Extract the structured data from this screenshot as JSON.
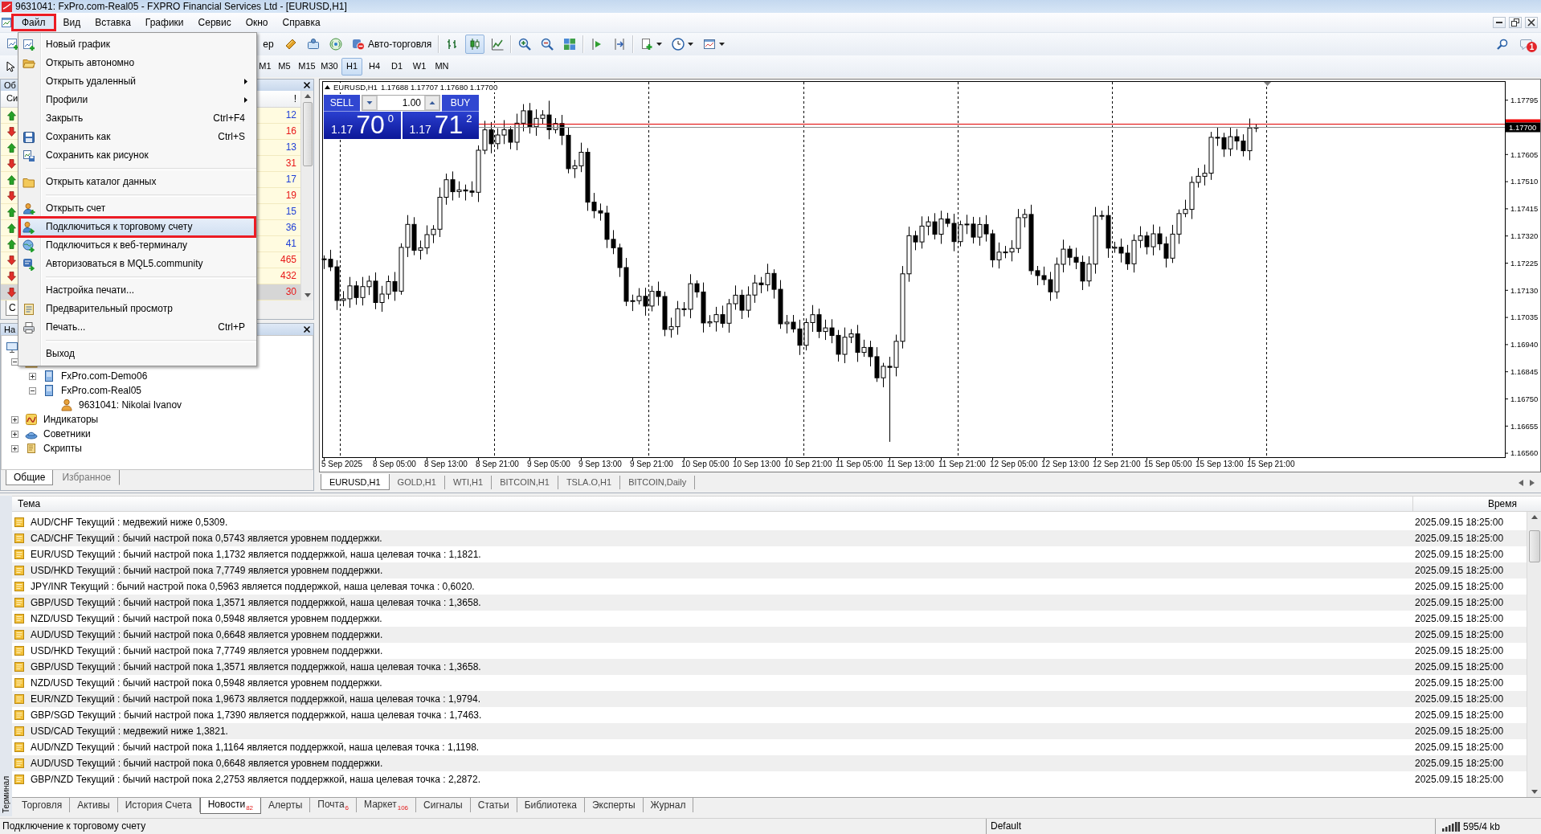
{
  "window": {
    "title": "9631041: FxPro.com-Real05 - FXPRO Financial Services Ltd - [EURUSD,H1]"
  },
  "menu_bar": [
    {
      "label": "Файл",
      "selected": true,
      "annotated": true
    },
    {
      "label": "Вид",
      "selected": false,
      "annotated": false
    },
    {
      "label": "Вставка",
      "selected": false,
      "annotated": false
    },
    {
      "label": "Графики",
      "selected": false,
      "annotated": false
    },
    {
      "label": "Сервис",
      "selected": false,
      "annotated": false
    },
    {
      "label": "Окно",
      "selected": false,
      "annotated": false
    },
    {
      "label": "Справка",
      "selected": false,
      "annotated": false
    }
  ],
  "file_menu": {
    "groups": [
      [
        {
          "label": "Новый график",
          "submenu": false,
          "selected": false,
          "annotated": false
        },
        {
          "label": "Открыть автономно",
          "submenu": false,
          "selected": false,
          "annotated": false
        },
        {
          "label": "Открыть удаленный",
          "submenu": true,
          "selected": false,
          "annotated": false
        },
        {
          "label": "Профили",
          "submenu": true,
          "selected": false,
          "annotated": false
        },
        {
          "label": "Закрыть",
          "shortcut": "Ctrl+F4",
          "submenu": false,
          "selected": false,
          "annotated": false
        },
        {
          "label": "Сохранить как",
          "shortcut": "Ctrl+S",
          "submenu": false,
          "selected": false,
          "annotated": false
        },
        {
          "label": "Сохранить как рисунок",
          "submenu": false,
          "selected": false,
          "annotated": false
        }
      ],
      [
        {
          "label": "Открыть каталог данных",
          "submenu": false,
          "selected": false,
          "annotated": false
        }
      ],
      [
        {
          "label": "Открыть счет",
          "submenu": false,
          "selected": false,
          "annotated": false
        },
        {
          "label": "Подключиться к торговому счету",
          "submenu": false,
          "selected": true,
          "annotated": true
        },
        {
          "label": "Подключиться к веб-терминалу",
          "submenu": false,
          "selected": false,
          "annotated": false
        },
        {
          "label": "Авторизоваться в MQL5.community",
          "submenu": false,
          "selected": false,
          "annotated": false
        }
      ],
      [
        {
          "label": "Настройка печати...",
          "submenu": false,
          "selected": false,
          "annotated": false
        },
        {
          "label": "Предварительный просмотр",
          "submenu": false,
          "selected": false,
          "annotated": false
        },
        {
          "label": "Печать...",
          "shortcut": "Ctrl+P",
          "submenu": false,
          "selected": false,
          "annotated": false
        }
      ],
      [
        {
          "label": "Выход",
          "submenu": false,
          "selected": false,
          "annotated": false
        }
      ]
    ]
  },
  "toolbar": {
    "groups": [
      [
        {
          "pressed": false,
          "dropdown": false
        }
      ],
      [
        {
          "label": "ер",
          "pressed": false,
          "dropdown": false
        },
        {
          "pressed": false,
          "dropdown": false
        },
        {
          "pressed": false,
          "dropdown": false
        },
        {
          "pressed": false,
          "dropdown": false
        },
        {
          "label": "Авто-торговля",
          "pressed": false,
          "dropdown": false
        }
      ],
      [
        {
          "pressed": false,
          "dropdown": false
        },
        {
          "pressed": true,
          "dropdown": false
        },
        {
          "pressed": false,
          "dropdown": false
        }
      ],
      [
        {
          "pressed": false,
          "dropdown": false
        },
        {
          "pressed": false,
          "dropdown": false
        },
        {
          "pressed": false,
          "dropdown": false
        }
      ],
      [
        {
          "pressed": false,
          "dropdown": false
        },
        {
          "pressed": false,
          "dropdown": false
        }
      ],
      [
        {
          "pressed": false,
          "dropdown": true
        },
        {
          "pressed": false,
          "dropdown": true
        },
        {
          "pressed": false,
          "dropdown": true
        }
      ]
    ],
    "notifications": {
      "badge": "1"
    }
  },
  "timeframes": [
    {
      "label": "M1",
      "selected": false
    },
    {
      "label": "M5",
      "selected": false
    },
    {
      "label": "M15",
      "selected": false
    },
    {
      "label": "M30",
      "selected": false
    },
    {
      "label": "H1",
      "selected": true
    },
    {
      "label": "H4",
      "selected": false
    },
    {
      "label": "D1",
      "selected": false
    },
    {
      "label": "W1",
      "selected": false
    },
    {
      "label": "MN",
      "selected": false
    }
  ],
  "market_watch": {
    "title": "Об",
    "columns": [
      "Си",
      "!"
    ],
    "rows": [
      {
        "rising": true,
        "spread": "12",
        "selected": false
      },
      {
        "rising": false,
        "spread": "16",
        "selected": false
      },
      {
        "rising": true,
        "spread": "13",
        "selected": false
      },
      {
        "rising": false,
        "spread": "31",
        "selected": false
      },
      {
        "rising": true,
        "spread": "17",
        "selected": false
      },
      {
        "rising": false,
        "spread": "19",
        "selected": false
      },
      {
        "rising": true,
        "spread": "15",
        "selected": false
      },
      {
        "rising": true,
        "spread": "36",
        "selected": false
      },
      {
        "rising": true,
        "spread": "41",
        "selected": false
      },
      {
        "rising": false,
        "spread": "465",
        "selected": false
      },
      {
        "rising": false,
        "spread": "432",
        "selected": false
      },
      {
        "rising": false,
        "spread": "30",
        "selected": true
      }
    ],
    "tabs": [
      {
        "label": "С",
        "selected": true
      }
    ]
  },
  "navigator": {
    "title": "На",
    "tree": [
      {
        "kind": "terminal",
        "children": [
          {
            "kind": "accounts",
            "expanded": true,
            "children": [
              {
                "kind": "server",
                "label": "FxPro.com-Demo06",
                "expanded": false
              },
              {
                "kind": "server",
                "label": "FxPro.com-Real05",
                "expanded": true,
                "children": [
                  {
                    "kind": "account",
                    "label": "9631041: Nikolai Ivanov"
                  }
                ]
              }
            ]
          },
          {
            "kind": "indicators",
            "label": "Индикаторы",
            "expanded": false
          },
          {
            "kind": "experts",
            "label": "Советники",
            "expanded": false
          },
          {
            "kind": "scripts",
            "label": "Скрипты",
            "expanded": false
          }
        ]
      }
    ],
    "tabs": [
      {
        "label": "Общие",
        "selected": true
      },
      {
        "label": "Избранное",
        "selected": false
      }
    ]
  },
  "chart": {
    "symbol": "EURUSD,H1",
    "ohlc": "1.17688 1.17707 1.17680 1.17700",
    "trade_panel": {
      "sell_label": "SELL",
      "buy_label": "BUY",
      "lot": "1.00",
      "sell_price": {
        "prefix": "1.17",
        "pips": "70",
        "point": "0"
      },
      "buy_price": {
        "prefix": "1.17",
        "pips": "71",
        "point": "2"
      }
    },
    "price_axis": [
      "1.17795",
      "1.17605",
      "1.17510",
      "1.17415",
      "1.17320",
      "1.17225",
      "1.17130",
      "1.17035",
      "1.16940",
      "1.16845",
      "1.16750",
      "1.16655",
      "1.16560"
    ],
    "current_price": "1.17700",
    "time_axis": [
      "5 Sep 2025",
      "8 Sep 05:00",
      "8 Sep 13:00",
      "8 Sep 21:00",
      "9 Sep 05:00",
      "9 Sep 13:00",
      "9 Sep 21:00",
      "10 Sep 05:00",
      "10 Sep 13:00",
      "10 Sep 21:00",
      "11 Sep 05:00",
      "11 Sep 13:00",
      "11 Sep 21:00",
      "12 Sep 05:00",
      "12 Sep 13:00",
      "12 Sep 21:00",
      "15 Sep 05:00",
      "15 Sep 13:00",
      "15 Sep 21:00"
    ]
  },
  "chart_tabs": [
    {
      "label": "EURUSD,H1",
      "selected": true
    },
    {
      "label": "GOLD,H1",
      "selected": false
    },
    {
      "label": "WTI,H1",
      "selected": false
    },
    {
      "label": "BITCOIN,H1",
      "selected": false
    },
    {
      "label": "TSLA.O,H1",
      "selected": false
    },
    {
      "label": "BITCOIN,Daily",
      "selected": false
    }
  ],
  "terminal": {
    "side_label": "Терминал",
    "columns": [
      "Тема",
      "Время"
    ],
    "rows": [
      {
        "subject": "AUD/CHF Текущий : медвежий ниже 0,5309.",
        "time": "2025.09.15 18:25:00"
      },
      {
        "subject": "CAD/CHF Текущий : бычий настрой пока 0,5743 является уровнем поддержки.",
        "time": "2025.09.15 18:25:00"
      },
      {
        "subject": "EUR/USD Текущий : бычий настрой пока 1,1732 является поддержкой, наша целевая точка : 1,1821.",
        "time": "2025.09.15 18:25:00"
      },
      {
        "subject": "USD/HKD Текущий : бычий настрой пока 7,7749 является уровнем поддержки.",
        "time": "2025.09.15 18:25:00"
      },
      {
        "subject": "JPY/INR Текущий : бычий настрой пока 0,5963 является поддержкой, наша целевая точка : 0,6020.",
        "time": "2025.09.15 18:25:00"
      },
      {
        "subject": "GBP/USD Текущий : бычий настрой пока 1,3571 является поддержкой, наша целевая точка : 1,3658.",
        "time": "2025.09.15 18:25:00"
      },
      {
        "subject": "NZD/USD Текущий : бычий настрой пока 0,5948 является уровнем поддержки.",
        "time": "2025.09.15 18:25:00"
      },
      {
        "subject": "AUD/USD Текущий : бычий настрой пока 0,6648 является уровнем поддержки.",
        "time": "2025.09.15 18:25:00"
      },
      {
        "subject": "USD/HKD Текущий : бычий настрой пока 7,7749 является уровнем поддержки.",
        "time": "2025.09.15 18:25:00"
      },
      {
        "subject": "GBP/USD Текущий : бычий настрой пока 1,3571 является поддержкой, наша целевая точка : 1,3658.",
        "time": "2025.09.15 18:25:00"
      },
      {
        "subject": "NZD/USD Текущий : бычий настрой пока 0,5948 является уровнем поддержки.",
        "time": "2025.09.15 18:25:00"
      },
      {
        "subject": "EUR/NZD Текущий : бычий настрой пока 1,9673 является поддержкой, наша целевая точка : 1,9794.",
        "time": "2025.09.15 18:25:00"
      },
      {
        "subject": "GBP/SGD Текущий : бычий настрой пока 1,7390 является поддержкой, наша целевая точка : 1,7463.",
        "time": "2025.09.15 18:25:00"
      },
      {
        "subject": "USD/CAD Текущий : медвежий ниже 1,3821.",
        "time": "2025.09.15 18:25:00"
      },
      {
        "subject": "AUD/NZD Текущий : бычий настрой пока 1,1164 является поддержкой, наша целевая точка : 1,1198.",
        "time": "2025.09.15 18:25:00"
      },
      {
        "subject": "AUD/USD Текущий : бычий настрой пока 0,6648 является уровнем поддержки.",
        "time": "2025.09.15 18:25:00"
      },
      {
        "subject": "GBP/NZD Текущий : бычий настрой пока 2,2753 является поддержкой, наша целевая точка : 2,2872.",
        "time": "2025.09.15 18:25:00"
      }
    ],
    "tabs": [
      {
        "label": "Торговля",
        "selected": false
      },
      {
        "label": "Активы",
        "selected": false
      },
      {
        "label": "История Счета",
        "selected": false
      },
      {
        "label": "Новости",
        "selected": true,
        "badge": "82"
      },
      {
        "label": "Алерты",
        "selected": false
      },
      {
        "label": "Почта",
        "selected": false,
        "badge": "6"
      },
      {
        "label": "Маркет",
        "selected": false,
        "badge": "106"
      },
      {
        "label": "Сигналы",
        "selected": false
      },
      {
        "label": "Статьи",
        "selected": false
      },
      {
        "label": "Библиотека",
        "selected": false
      },
      {
        "label": "Эксперты",
        "selected": false
      },
      {
        "label": "Журнал",
        "selected": false
      }
    ]
  },
  "status_bar": {
    "message": "Подключение к торговому счету",
    "profile": "Default",
    "traffic": "595/4 kb"
  }
}
